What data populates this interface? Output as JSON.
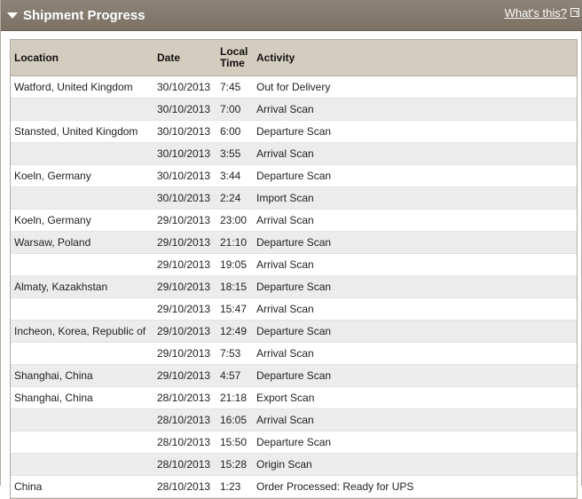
{
  "header": {
    "title": "Shipment Progress",
    "help_link": "What's this?"
  },
  "table": {
    "columns": {
      "location": "Location",
      "date": "Date",
      "time_line1": "Local",
      "time_line2": "Time",
      "activity": "Activity"
    },
    "rows": [
      {
        "location": "Watford, United Kingdom",
        "date": "30/10/2013",
        "time": "7:45",
        "activity": "Out for Delivery"
      },
      {
        "location": "",
        "date": "30/10/2013",
        "time": "7:00",
        "activity": "Arrival Scan"
      },
      {
        "location": "Stansted, United Kingdom",
        "date": "30/10/2013",
        "time": "6:00",
        "activity": "Departure Scan"
      },
      {
        "location": "",
        "date": "30/10/2013",
        "time": "3:55",
        "activity": "Arrival Scan"
      },
      {
        "location": "Koeln, Germany",
        "date": "30/10/2013",
        "time": "3:44",
        "activity": "Departure Scan"
      },
      {
        "location": "",
        "date": "30/10/2013",
        "time": "2:24",
        "activity": "Import Scan"
      },
      {
        "location": "Koeln, Germany",
        "date": "29/10/2013",
        "time": "23:00",
        "activity": "Arrival Scan"
      },
      {
        "location": "Warsaw, Poland",
        "date": "29/10/2013",
        "time": "21:10",
        "activity": "Departure Scan"
      },
      {
        "location": "",
        "date": "29/10/2013",
        "time": "19:05",
        "activity": "Arrival Scan"
      },
      {
        "location": "Almaty, Kazakhstan",
        "date": "29/10/2013",
        "time": "18:15",
        "activity": "Departure Scan"
      },
      {
        "location": "",
        "date": "29/10/2013",
        "time": "15:47",
        "activity": "Arrival Scan"
      },
      {
        "location": "Incheon, Korea, Republic of",
        "date": "29/10/2013",
        "time": "12:49",
        "activity": "Departure Scan"
      },
      {
        "location": "",
        "date": "29/10/2013",
        "time": "7:53",
        "activity": "Arrival Scan"
      },
      {
        "location": "Shanghai, China",
        "date": "29/10/2013",
        "time": "4:57",
        "activity": "Departure Scan"
      },
      {
        "location": "Shanghai, China",
        "date": "28/10/2013",
        "time": "21:18",
        "activity": "Export Scan"
      },
      {
        "location": "",
        "date": "28/10/2013",
        "time": "16:05",
        "activity": "Arrival Scan"
      },
      {
        "location": "",
        "date": "28/10/2013",
        "time": "15:50",
        "activity": "Departure Scan"
      },
      {
        "location": "",
        "date": "28/10/2013",
        "time": "15:28",
        "activity": "Origin Scan"
      },
      {
        "location": "China",
        "date": "28/10/2013",
        "time": "1:23",
        "activity": "Order Processed: Ready for UPS"
      }
    ]
  }
}
